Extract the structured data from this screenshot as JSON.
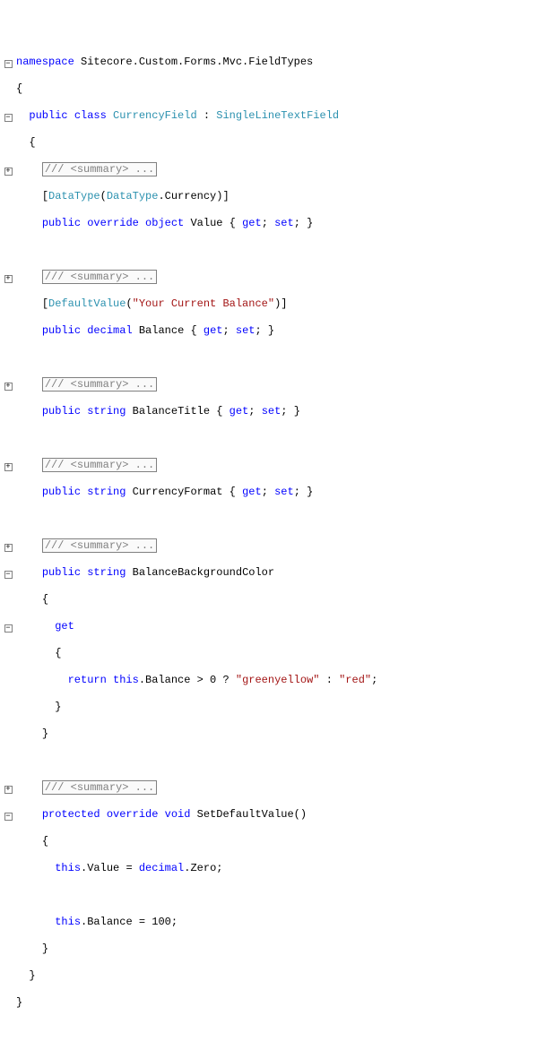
{
  "ns": {
    "kw_namespace": "namespace",
    "name": " Sitecore.Custom.Forms.Mvc.FieldTypes"
  },
  "cls": {
    "kw_public": "public",
    "kw_class": "class",
    "name": "CurrencyField",
    "colon": " : ",
    "base": "SingleLineTextField"
  },
  "summary": "/// <summary> ...",
  "p1": {
    "attr_open": "[",
    "attr_type": "DataType",
    "attr_paren": "(",
    "attr_enum": "DataType",
    "attr_dot": ".Currency)]",
    "kw_public": "public",
    "kw_override": "override",
    "kw_object": "object",
    "name": " Value { ",
    "kw_get": "get",
    "semi1": "; ",
    "kw_set": "set",
    "semi2": "; }"
  },
  "p2": {
    "attr_open": "[",
    "attr_type": "DefaultValue",
    "attr_paren": "(",
    "attr_str": "\"Your Current Balance\"",
    "attr_close": ")]",
    "kw_public": "public",
    "kw_decimal": "decimal",
    "name": " Balance { ",
    "kw_get": "get",
    "semi1": "; ",
    "kw_set": "set",
    "semi2": "; }"
  },
  "p3": {
    "kw_public": "public",
    "kw_string": "string",
    "name": " BalanceTitle { ",
    "kw_get": "get",
    "semi1": "; ",
    "kw_set": "set",
    "semi2": "; }"
  },
  "p4": {
    "kw_public": "public",
    "kw_string": "string",
    "name": " CurrencyFormat { ",
    "kw_get": "get",
    "semi1": "; ",
    "kw_set": "set",
    "semi2": "; }"
  },
  "p5": {
    "kw_public": "public",
    "kw_string": "string",
    "name": " BalanceBackgroundColor",
    "brace_open": "{",
    "kw_get": "get",
    "get_brace_open": "{",
    "kw_return": "return",
    "kw_this": "this",
    "expr_mid": ".Balance > 0 ? ",
    "str_true": "\"greenyellow\"",
    "expr_colon": " : ",
    "str_false": "\"red\"",
    "expr_end": ";",
    "get_brace_close": "}",
    "brace_close": "}"
  },
  "m1": {
    "kw_protected": "protected",
    "kw_override": "override",
    "kw_void": "void",
    "name": " SetDefaultValue()",
    "brace_open": "{",
    "kw_this1": "this",
    "dot_value": ".Value = ",
    "kw_decimal": "decimal",
    "dot_zero": ".Zero;",
    "kw_this2": "this",
    "dot_balance": ".Balance = 100;",
    "brace_close": "}"
  },
  "braces": {
    "open": "{",
    "close": "}"
  }
}
